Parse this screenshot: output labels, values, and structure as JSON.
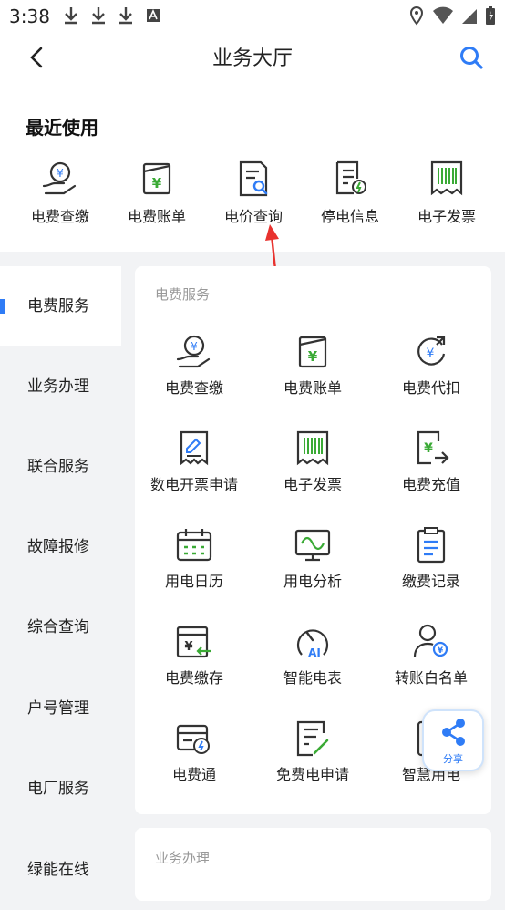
{
  "status": {
    "time": "3:38"
  },
  "header": {
    "title": "业务大厅"
  },
  "recent": {
    "title": "最近使用",
    "items": [
      {
        "label": "电费查缴",
        "icon": "bill-pay-icon"
      },
      {
        "label": "电费账单",
        "icon": "bill-icon"
      },
      {
        "label": "电价查询",
        "icon": "price-query-icon"
      },
      {
        "label": "停电信息",
        "icon": "outage-info-icon"
      },
      {
        "label": "电子发票",
        "icon": "e-invoice-icon"
      }
    ]
  },
  "sidebar": {
    "items": [
      {
        "label": "电费服务",
        "active": true
      },
      {
        "label": "业务办理"
      },
      {
        "label": "联合服务"
      },
      {
        "label": "故障报修"
      },
      {
        "label": "综合查询"
      },
      {
        "label": "户号管理"
      },
      {
        "label": "电厂服务"
      },
      {
        "label": "绿能在线"
      }
    ]
  },
  "section": {
    "title": "电费服务",
    "items": [
      {
        "label": "电费查缴"
      },
      {
        "label": "电费账单"
      },
      {
        "label": "电费代扣"
      },
      {
        "label": "数电开票申请"
      },
      {
        "label": "电子发票"
      },
      {
        "label": "电费充值"
      },
      {
        "label": "用电日历"
      },
      {
        "label": "用电分析"
      },
      {
        "label": "缴费记录"
      },
      {
        "label": "电费缴存"
      },
      {
        "label": "智能电表"
      },
      {
        "label": "转账白名单"
      },
      {
        "label": "电费通"
      },
      {
        "label": "免费电申请"
      },
      {
        "label": "智慧用电"
      }
    ]
  },
  "section2": {
    "title": "业务办理"
  },
  "share": {
    "label": "分享"
  },
  "colors": {
    "accent": "#2f7cf6",
    "green": "#3aaa35",
    "arrow": "#e8322e"
  }
}
